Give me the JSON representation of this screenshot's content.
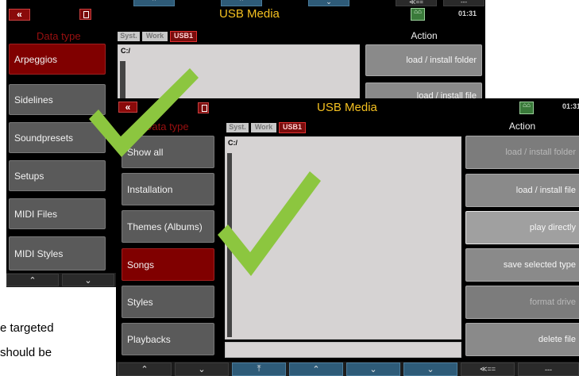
{
  "back_screen": {
    "title": "USB Media",
    "time": "01:31",
    "home_badge": "⌂⌂",
    "data_type_label": "Data type",
    "sidebar": [
      "Arpeggios",
      "Sidelines",
      "Soundpresets",
      "Setups",
      "MIDI Files",
      "MIDI Styles"
    ],
    "active_sidebar": "Arpeggios",
    "tabs": {
      "syst": "Syst.",
      "work": "Work",
      "usb": "USB1"
    },
    "path": "C:/",
    "action_title": "Action",
    "actions": [
      "load  /  install folder",
      "load  /  install file"
    ],
    "nav": [
      "⌃",
      "⌄"
    ]
  },
  "front_screen": {
    "title": "USB Media",
    "time": "01:31",
    "home_badge": "⌂⌂",
    "data_type_label": "Data type",
    "sidebar": [
      "Show all",
      "Installation",
      "Themes (Albums)",
      "Songs",
      "Styles",
      "Playbacks"
    ],
    "active_sidebar": "Songs",
    "tabs": {
      "syst": "Syst.",
      "work": "Work",
      "usb": "USB1"
    },
    "path": "C:/",
    "action_title": "Action",
    "actions": [
      {
        "label": "load  /  install folder",
        "state": "disabled"
      },
      {
        "label": "load  /  install file",
        "state": "normal"
      },
      {
        "label": "play directly",
        "state": "highlighted"
      },
      {
        "label": "save selected type",
        "state": "normal"
      },
      {
        "label": "format drive",
        "state": "disabled"
      },
      {
        "label": "delete file",
        "state": "normal"
      }
    ],
    "nav": [
      "⌃",
      "⌄",
      "⤒",
      "⌃",
      "⌄",
      "⌄",
      "≪==",
      "---"
    ]
  },
  "back_top_strip": [
    "⌃",
    "⌃",
    "⌄",
    "≪==",
    "---"
  ],
  "caption_lines": [
    "e targeted",
    "should  be"
  ],
  "colors": {
    "checkmark": "#8cc63f",
    "title": "#f4c020",
    "active": "#800000"
  }
}
